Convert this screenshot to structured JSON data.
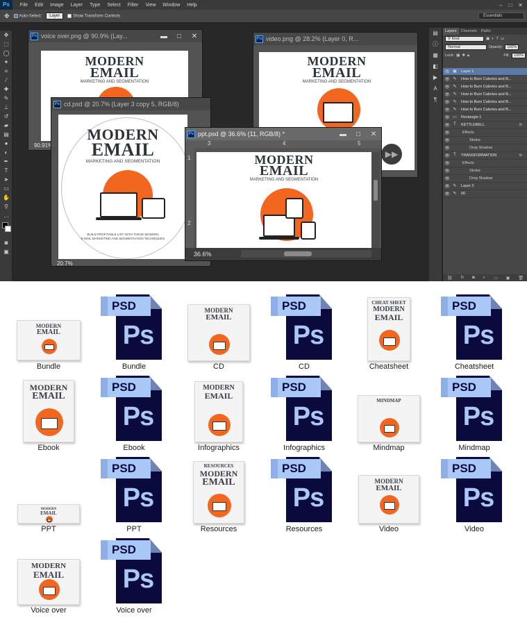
{
  "ps": {
    "app_logo": "Ps",
    "menu": [
      "File",
      "Edit",
      "Image",
      "Layer",
      "Type",
      "Select",
      "Filter",
      "View",
      "Window",
      "Help"
    ],
    "options": {
      "auto_select": "Auto-Select:",
      "layer_dropdown": "Layer",
      "show_transform": "Show Transform Controls",
      "workspace": "Essentials"
    },
    "docs": {
      "voice": {
        "title": "voice over.png @ 90.9% (Lay...",
        "zoom": "90.91%"
      },
      "video": {
        "title": "video.png @ 28.2% (Layer 0, R..."
      },
      "cd": {
        "title": "cd.psd @ 20.7% (Layer 3 copy 5, RGB/8)",
        "zoom": "20.7%"
      },
      "ppt": {
        "title": "ppt.psd @ 36.6% (11, RGB/8) *",
        "zoom": "36.6%",
        "ruler": [
          "3",
          "4",
          "5"
        ],
        "vruler": [
          "1",
          "2"
        ]
      }
    },
    "artwork": {
      "line1": "MODERN",
      "line2": "EMAIL",
      "line3": "MARKETING AND SEGMENTATION",
      "tagline1": "BUILD PROFITABLE LIST WITH THESE MODERN",
      "tagline2": "E-MAIL MARKETING AND SEGMENTATION TECHNIQUES"
    },
    "layers_panel": {
      "tabs": [
        "Layers",
        "Channels",
        "Paths"
      ],
      "kind": "Kind",
      "blend": "Normal",
      "opacity_label": "Opacity:",
      "opacity": "100%",
      "lock_label": "Lock:",
      "fill_label": "Fill:",
      "fill": "100%",
      "layers": [
        {
          "name": "Layer 1",
          "type": "pixel",
          "selected": true
        },
        {
          "name": "How to Burn Calories and B...",
          "type": "brush"
        },
        {
          "name": "How to Burn Calories and B...",
          "type": "brush"
        },
        {
          "name": "How to Burn Calories and B...",
          "type": "brush"
        },
        {
          "name": "How to Burn Calories and B...",
          "type": "brush"
        },
        {
          "name": "How to Burn Calories and B...",
          "type": "brush"
        },
        {
          "name": "Rectangle 1",
          "type": "shape"
        },
        {
          "name": "KETTLEBELL",
          "type": "text",
          "fx": "fx"
        },
        {
          "name": "Effects",
          "type": "sub1"
        },
        {
          "name": "Stroke",
          "type": "sub2"
        },
        {
          "name": "Drop Shadow",
          "type": "sub2"
        },
        {
          "name": "TRANSFORMATION",
          "type": "text",
          "fx": "fx"
        },
        {
          "name": "Effects",
          "type": "sub1"
        },
        {
          "name": "Stroke",
          "type": "sub2"
        },
        {
          "name": "Drop Shadow",
          "type": "sub2"
        },
        {
          "name": "Layer 3",
          "type": "brush"
        },
        {
          "name": "00",
          "type": "brush"
        }
      ]
    }
  },
  "files": [
    {
      "label": "Bundle",
      "kind": "bundle"
    },
    {
      "label": "Bundle",
      "kind": "psd"
    },
    {
      "label": "CD",
      "kind": "cd"
    },
    {
      "label": "CD",
      "kind": "psd"
    },
    {
      "label": "Cheatsheet",
      "kind": "cheatsheet",
      "text": "CHEAT SHEET"
    },
    {
      "label": "Cheatsheet",
      "kind": "psd"
    },
    {
      "label": "Ebook",
      "kind": "ebook"
    },
    {
      "label": "Ebook",
      "kind": "psd"
    },
    {
      "label": "Infographics",
      "kind": "infographics"
    },
    {
      "label": "Infographics",
      "kind": "psd"
    },
    {
      "label": "Mindmap",
      "kind": "mindmap",
      "text": "MINDMAP"
    },
    {
      "label": "Mindmap",
      "kind": "psd"
    },
    {
      "label": "PPT",
      "kind": "ppt"
    },
    {
      "label": "PPT",
      "kind": "psd"
    },
    {
      "label": "Resources",
      "kind": "resources",
      "text": "RESOURCES"
    },
    {
      "label": "Resources",
      "kind": "psd"
    },
    {
      "label": "Video",
      "kind": "video"
    },
    {
      "label": "Video",
      "kind": "psd"
    },
    {
      "label": "Voice over",
      "kind": "voice"
    },
    {
      "label": "Voice over",
      "kind": "psd"
    }
  ],
  "psd_icon": {
    "tag": "PSD",
    "glyph": "Ps"
  },
  "colors": {
    "accent_orange": "#f2661f",
    "ps_navy": "#0a0a3c",
    "ps_blue": "#a9c8f7",
    "selected_layer": "#5a7aa8"
  }
}
